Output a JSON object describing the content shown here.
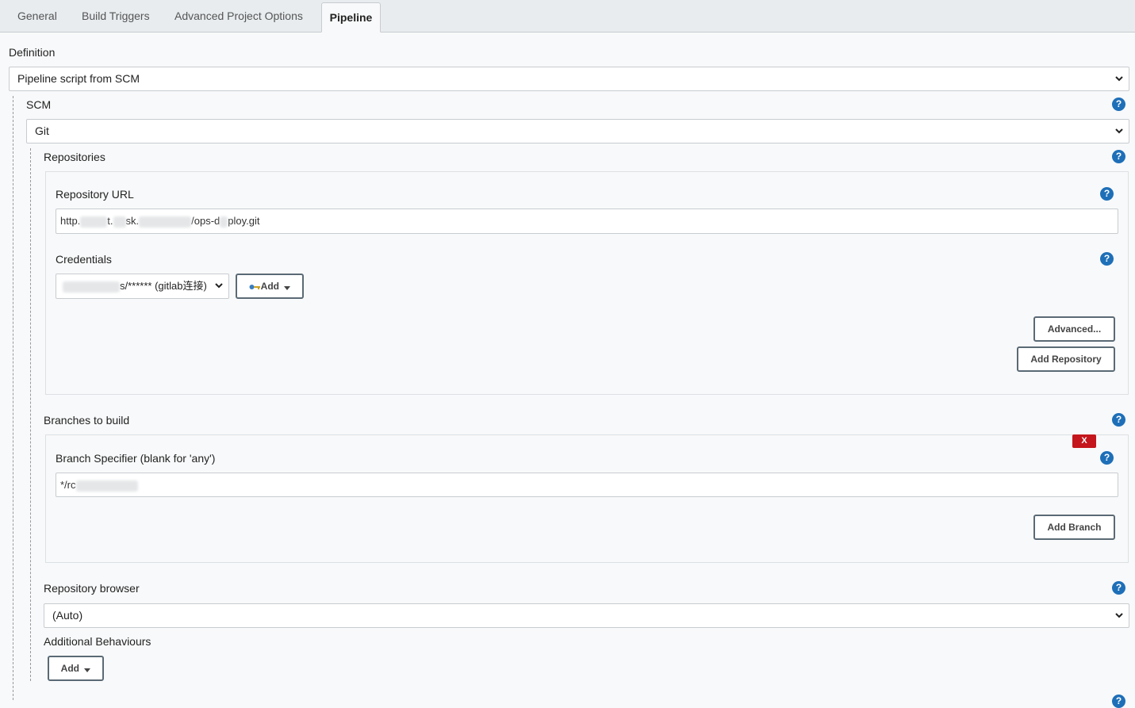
{
  "tabs": [
    {
      "label": "General"
    },
    {
      "label": "Build Triggers"
    },
    {
      "label": "Advanced Project Options"
    },
    {
      "label": "Pipeline"
    }
  ],
  "definition": {
    "label": "Definition",
    "selected": "Pipeline script from SCM"
  },
  "scm": {
    "label": "SCM",
    "selected": "Git"
  },
  "repositories": {
    "label": "Repositories",
    "url_label": "Repository URL",
    "url_prefix": "http.",
    "url_mid1": "t.",
    "url_mid2": "sk.",
    "url_suffix": "/ops-d",
    "url_end": "ploy.git",
    "credentials_label": "Credentials",
    "credentials_partial": "s/****** (gitlab连接)",
    "add_label": "Add",
    "advanced_label": "Advanced...",
    "add_repository_label": "Add Repository"
  },
  "branches": {
    "label": "Branches to build",
    "delete_label": "X",
    "specifier_label": "Branch Specifier (blank for 'any')",
    "specifier_value": "*/rc",
    "add_branch_label": "Add Branch"
  },
  "browser": {
    "label": "Repository browser",
    "selected": "(Auto)"
  },
  "behaviours": {
    "label": "Additional Behaviours",
    "add_label": "Add"
  },
  "icons": {
    "help": "?",
    "help_icon": "help-icon",
    "chevron": "chevron-down-icon",
    "key": "key-icon"
  }
}
